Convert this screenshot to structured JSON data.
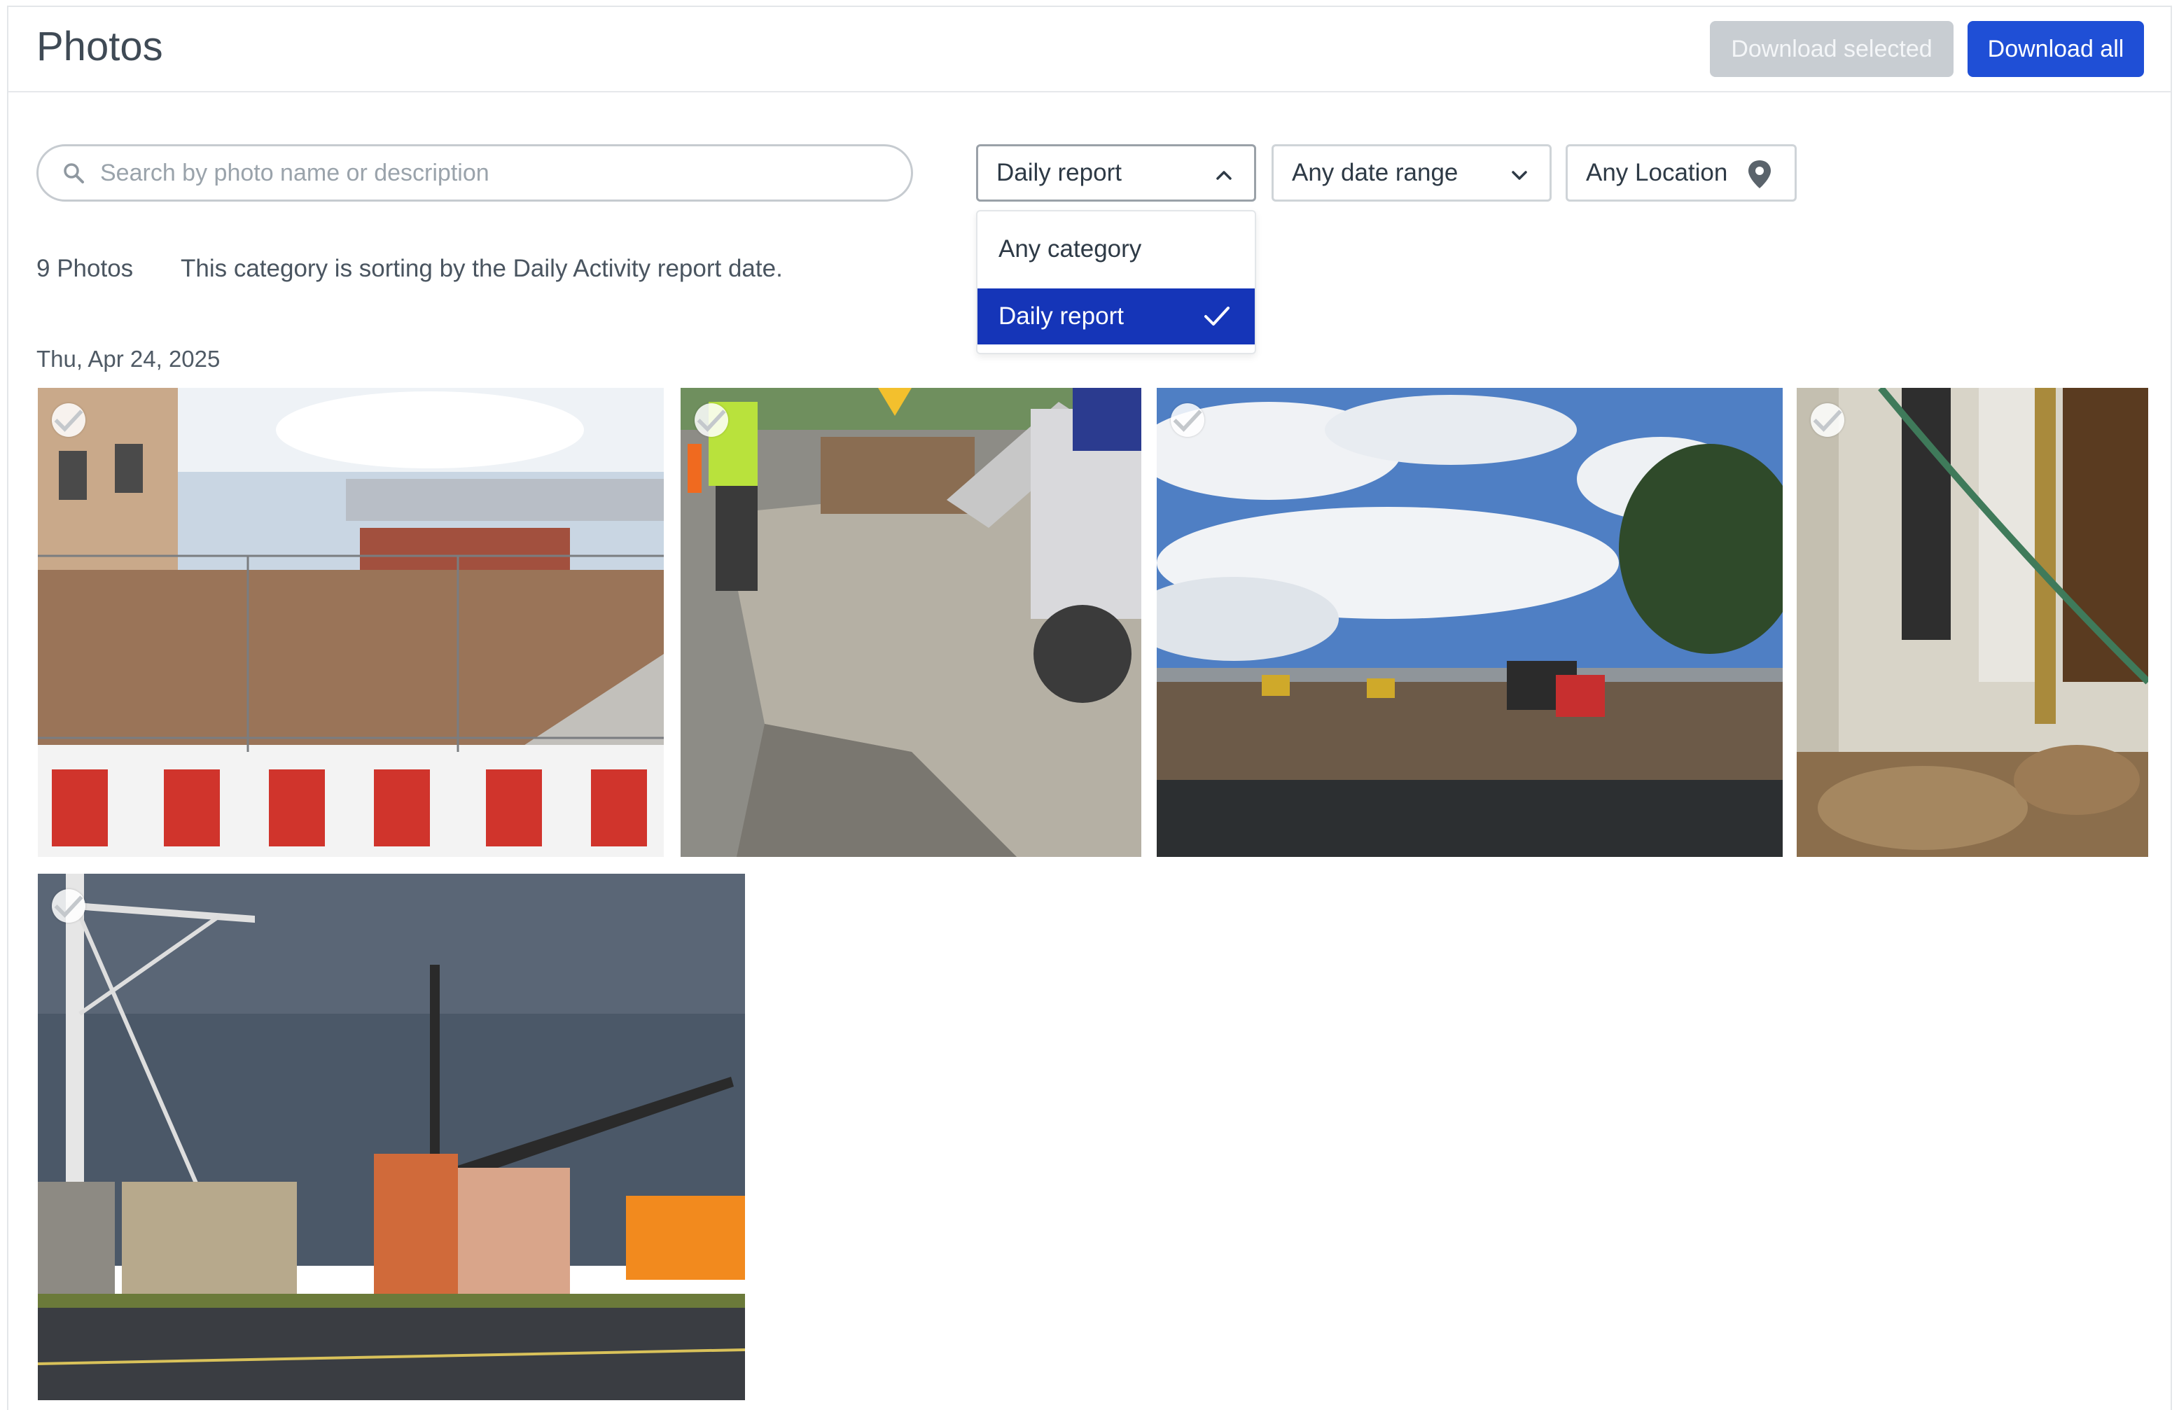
{
  "header": {
    "title": "Photos",
    "download_selected_label": "Download selected",
    "download_all_label": "Download all"
  },
  "search": {
    "placeholder": "Search by photo name or description",
    "value": ""
  },
  "filters": {
    "category": {
      "selected": "Daily report",
      "open": true
    },
    "date_range": {
      "selected": "Any date range"
    },
    "location": {
      "selected": "Any Location"
    }
  },
  "category_dropdown": {
    "options": [
      {
        "label": "Any category",
        "selected": false
      },
      {
        "label": "Daily report",
        "selected": true
      }
    ]
  },
  "summary": {
    "count_text": "9 Photos",
    "sort_note": "This category is sorting by the Daily Activity report date."
  },
  "groups": [
    {
      "date": "Thu, Apr 24, 2025",
      "photos": [
        {
          "description": "construction site with red and white barriers and fencing"
        },
        {
          "description": "workers pouring concrete at curb"
        },
        {
          "description": "cleared lot with dump trucks under cloudy sky"
        },
        {
          "description": "wall interior with pipes and debris"
        },
        {
          "description": "tower crane and buildings at intersection"
        }
      ]
    }
  ],
  "colors": {
    "primary": "#1f4fd6",
    "selected_option": "#1535b8",
    "disabled_button": "#c8cdd2"
  }
}
